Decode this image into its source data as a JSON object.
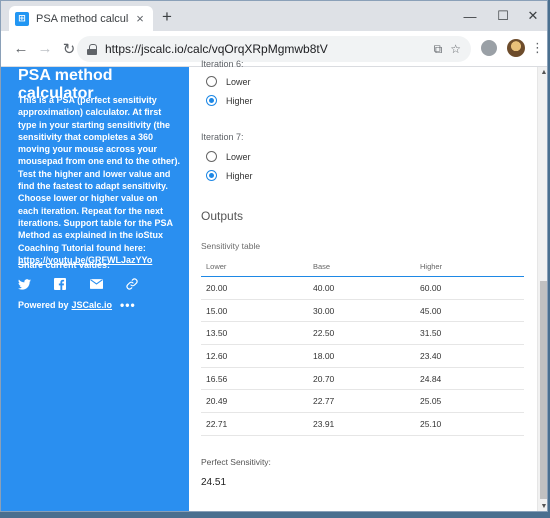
{
  "browser": {
    "tab_title": "PSA method calculator - JSCalc.io",
    "tab_close": "×",
    "new_tab": "+",
    "url": "https://jscalc.io/calc/vqOrqXRpMgmwb8tV",
    "window_controls": {
      "minimize": "—",
      "maximize": "☐",
      "close": "✕"
    },
    "menu": "⋮"
  },
  "sidebar": {
    "title": "PSA method calculator",
    "description": "This is a PSA (perfect sensitivity approximation) calculator. At first type in your starting sensitivity (the sensitivity that completes a 360 moving your mouse across your mousepad from one end to the other). Test the higher and lower value and find the fastest to adapt sensitivity. Choose lower or higher value on each iteration. Repeat for the next iterations. Support table for the PSA Method as explained in the ioStux Coaching Tutorial found here:",
    "youtube_link": "https://youtu.be/GRFWLJazYYo",
    "share_label": "Share current values:",
    "share_icons": [
      "twitter-icon",
      "facebook-icon",
      "mail-icon",
      "link-icon"
    ],
    "powered_by": "Powered by",
    "powered_link": "JSCalc.io",
    "more": "•••"
  },
  "inputs": {
    "iteration6": {
      "label": "Iteration 6:",
      "options": [
        "Lower",
        "Higher"
      ],
      "selected": "Higher"
    },
    "iteration7": {
      "label": "Iteration 7:",
      "options": [
        "Lower",
        "Higher"
      ],
      "selected": "Higher"
    }
  },
  "outputs": {
    "title": "Outputs",
    "table_label": "Sensitivity table",
    "columns": [
      "Lower",
      "Base",
      "Higher"
    ],
    "rows": [
      [
        "20.00",
        "40.00",
        "60.00"
      ],
      [
        "15.00",
        "30.00",
        "45.00"
      ],
      [
        "13.50",
        "22.50",
        "31.50"
      ],
      [
        "12.60",
        "18.00",
        "23.40"
      ],
      [
        "16.56",
        "20.70",
        "24.84"
      ],
      [
        "20.49",
        "22.77",
        "25.05"
      ],
      [
        "22.71",
        "23.91",
        "25.10"
      ]
    ],
    "perfect_label": "Perfect Sensitivity:",
    "perfect_value": "24.51"
  },
  "colors": {
    "sidebar": "#2a8ff0",
    "accent": "#1e88e5"
  }
}
